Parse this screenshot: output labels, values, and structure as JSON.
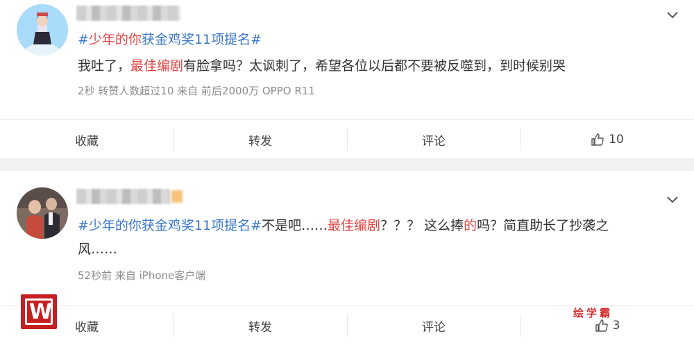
{
  "posts": [
    {
      "hashtag": "#少年的你获金鸡奖11项提名#",
      "hashtag_parts": [
        "#",
        "少年的你",
        "获金鸡奖11项提名#"
      ],
      "text_parts": [
        "我吐了，",
        "最佳编剧",
        "有脸拿吗？太讽刺了，希望各位以后都不要被反噬到，到时候别哭"
      ],
      "meta": "2秒 转赞人数超过10 来自 前后2000万 OPPO R11",
      "actions": {
        "favorite": "收藏",
        "repost": "转发",
        "comment": "评论",
        "likes": "10"
      }
    },
    {
      "text_parts": [
        "#少年的你获金鸡奖11项提名#",
        "不是吧……",
        "最佳编剧",
        "？？？ 这么捧",
        "的",
        "吗？简直助长了抄袭之风……"
      ],
      "meta": "52秒前 来自 iPhone客户端",
      "actions": {
        "favorite": "收藏",
        "repost": "转发",
        "comment": "评论",
        "likes": "3"
      }
    }
  ],
  "watermark": {
    "logo_letter": "W",
    "text": "绘学霸"
  },
  "icons": {
    "more": "chevron-down-icon",
    "like": "thumbs-up-icon"
  },
  "colors": {
    "hashtag": "#3a77c9",
    "highlight": "#e04646",
    "meta": "#8c8c8c"
  }
}
